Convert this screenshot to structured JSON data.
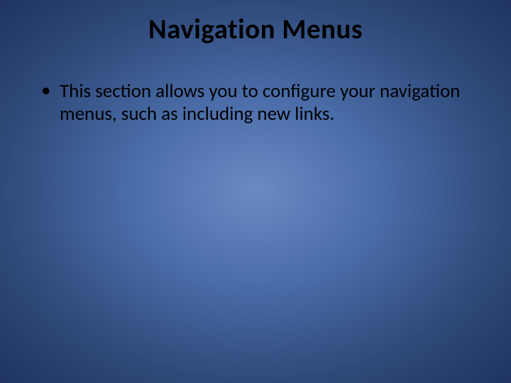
{
  "slide": {
    "title": "Navigation Menus",
    "bullets": [
      "This section allows you to configure your navigation menus, such as including new links."
    ]
  }
}
